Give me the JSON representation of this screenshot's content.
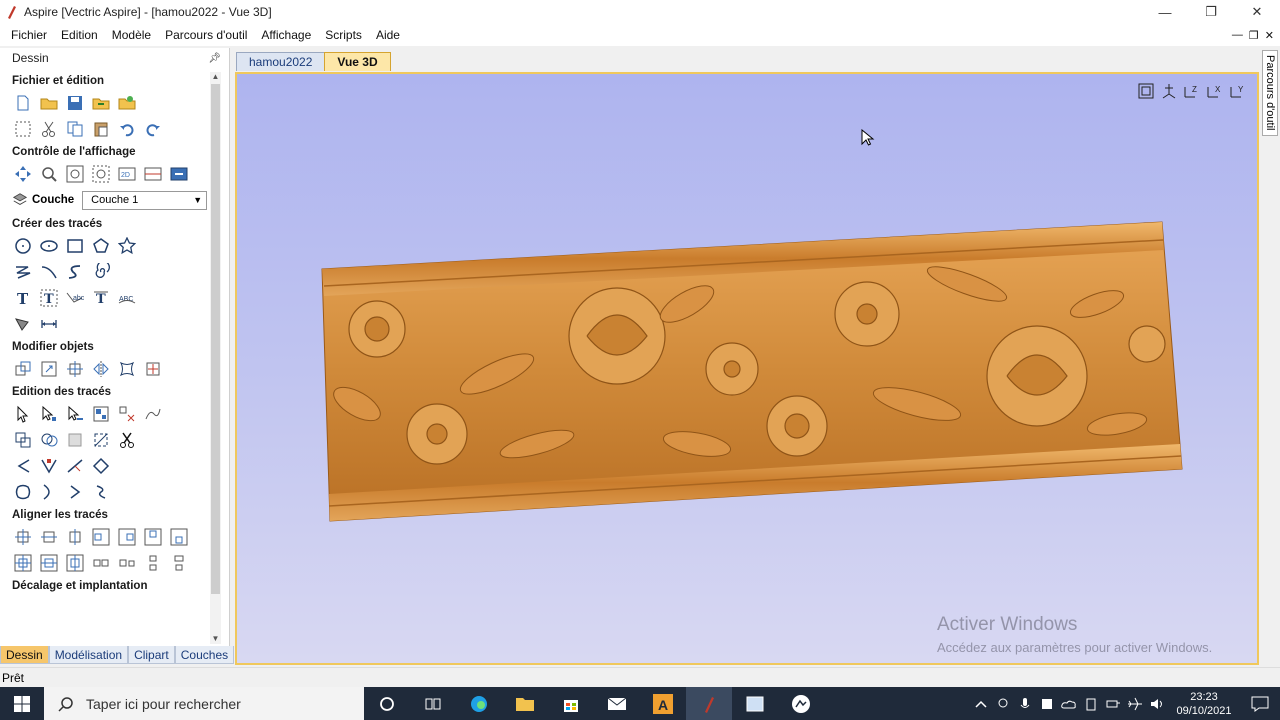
{
  "window": {
    "title": "Aspire [Vectric Aspire] - [hamou2022 - Vue 3D]"
  },
  "menu": [
    "Fichier",
    "Edition",
    "Modèle",
    "Parcours d'outil",
    "Affichage",
    "Scripts",
    "Aide"
  ],
  "panel": {
    "title": "Dessin",
    "sections": {
      "file": "Fichier et édition",
      "view": "Contrôle de l'affichage",
      "create": "Créer des tracés",
      "modify": "Modifier objets",
      "edit": "Edition des tracés",
      "align": "Aligner les tracés",
      "offset": "Décalage et implantation"
    },
    "layer": {
      "label": "Couche",
      "value": "Couche 1"
    },
    "bottom_tabs": [
      "Dessin",
      "Modélisation",
      "Clipart",
      "Couches"
    ]
  },
  "right_tab": "Parcours d'outil",
  "doc_tabs": [
    "hamou2022",
    "Vue 3D"
  ],
  "watermark": {
    "line1": "Activer Windows",
    "line2": "Accédez aux paramètres pour activer Windows."
  },
  "status": "Prêt",
  "taskbar": {
    "search_placeholder": "Taper ici pour rechercher",
    "time": "23:23",
    "date": "09/10/2021"
  },
  "colors": {
    "accent": "#f6c66b",
    "wood": "#d9923f",
    "taskbar": "#1f2a3a"
  }
}
